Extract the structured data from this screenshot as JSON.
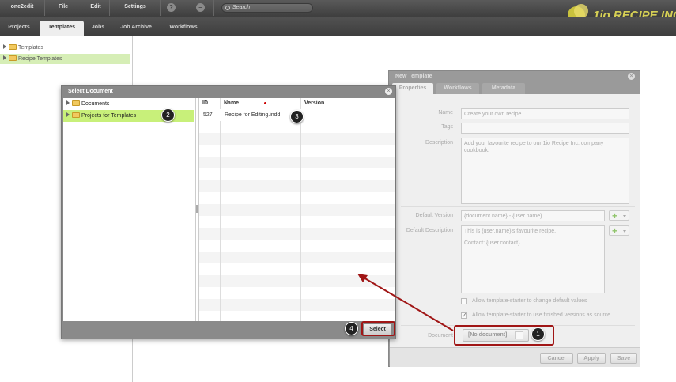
{
  "menubar": {
    "items": [
      "one2edit",
      "File",
      "Edit",
      "Settings"
    ],
    "help_icon": "?",
    "search_placeholder": "Search",
    "brand": "1io RECIPE INC."
  },
  "tabs": [
    "Projects",
    "Templates",
    "Jobs",
    "Job Archive",
    "Workflows"
  ],
  "active_tab": "Templates",
  "tree": [
    {
      "label": "Templates",
      "selected": false
    },
    {
      "label": "Recipe Templates",
      "selected": true
    }
  ],
  "template_panel": {
    "title": "New Template",
    "tabs": [
      "Properties",
      "Workflows",
      "Metadata"
    ],
    "name_label": "Name",
    "name_value": "Create your own recipe",
    "tags_label": "Tags",
    "tags_value": "",
    "description_label": "Description",
    "description_value": "Add your favourite recipe to our 1io Recipe Inc. company cookbook.",
    "default_version_label": "Default Version",
    "default_version_value": "{document.name} - {user.name}",
    "default_description_label": "Default Description",
    "default_description_line1": "This is {user.name}'s favourite recipe.",
    "default_description_line2": "Contact: {user.contact}",
    "check1_label": "Allow template-starter to change default values",
    "check1": false,
    "check2_label": "Allow template-starter to use finished versions as source",
    "check2": true,
    "document_label": "Document",
    "document_value": "[No document]",
    "cancel": "Cancel",
    "apply": "Apply",
    "save": "Save"
  },
  "dialog": {
    "title": "Select Document",
    "tree": [
      {
        "label": "Documents",
        "selected": false
      },
      {
        "label": "Projects for Templates",
        "selected": true
      }
    ],
    "columns": [
      "ID",
      "Name",
      "Version"
    ],
    "rows": [
      {
        "id": "527",
        "name": "Recipe for Editing.indd",
        "version": ""
      }
    ],
    "select": "Select"
  },
  "annotations": [
    "1",
    "2",
    "3",
    "4"
  ],
  "colors": {
    "selected_row": "#d6eeb6",
    "dialog_selected": "#c8f07a",
    "highlight": "#a01616",
    "brand": "#d6d055"
  }
}
